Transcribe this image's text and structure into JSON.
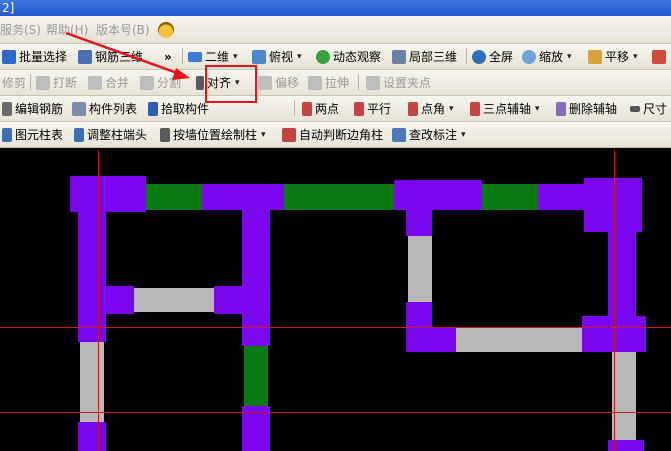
{
  "titlebar": {
    "text": "2]"
  },
  "menu": {
    "items": [
      "服务(S)",
      "帮助(H)",
      "版本号(B)"
    ]
  },
  "toolbar1": {
    "batch_select": "批量选择",
    "rebar_3d": "钢筋三维",
    "view_2d": "二维",
    "top_view": "俯视",
    "dynamic_view": "动态观察",
    "local_3d": "局部三维",
    "fullscreen": "全屏",
    "zoom": "缩放",
    "pan": "平移",
    "more": "»"
  },
  "toolbar2": {
    "trim": "修剪",
    "break": "打断",
    "merge": "合并",
    "split": "分割",
    "align": "对齐",
    "offset": "偏移",
    "stretch": "拉伸",
    "set_grip": "设置夹点"
  },
  "toolbar3": {
    "edit_rebar": "编辑钢筋",
    "component_list": "构件列表",
    "pick_component": "拾取构件",
    "two_points": "两点",
    "parallel": "平行",
    "point_angle": "点角",
    "three_point_aux": "三点辅轴",
    "delete_aux": "删除辅轴",
    "dimension": "尺寸"
  },
  "toolbar4": {
    "element_table": "图元柱表",
    "adjust_column_end": "调整柱端头",
    "draw_by_wall": "按墙位置绘制柱",
    "auto_corner_column": "自动判断边角柱",
    "check_annotation": "查改标注"
  },
  "colors": {
    "column": "#7b07f0",
    "beam_green": "#0a7a12",
    "beam_gray": "#b8b8b8",
    "axis_red": "#c8141b",
    "highlight": "#e4141a",
    "arrow": "#e4141a"
  }
}
